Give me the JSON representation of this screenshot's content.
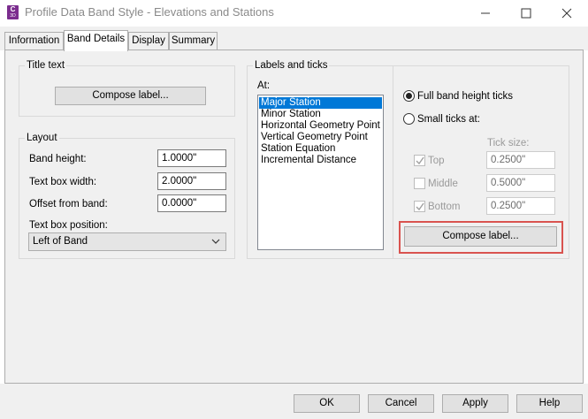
{
  "window": {
    "title": "Profile Data Band Style - Elevations and Stations",
    "icon_text": "C",
    "icon_sub": "3D"
  },
  "tabs": [
    {
      "label": "Information"
    },
    {
      "label": "Band Details"
    },
    {
      "label": "Display"
    },
    {
      "label": "Summary"
    }
  ],
  "title_text": {
    "group_label": "Title text",
    "compose_label": "Compose label..."
  },
  "layout": {
    "group_label": "Layout",
    "band_height_label": "Band height:",
    "band_height_value": "1.0000\"",
    "text_box_width_label": "Text box width:",
    "text_box_width_value": "2.0000\"",
    "offset_label": "Offset from band:",
    "offset_value": "0.0000\"",
    "position_label": "Text box position:",
    "position_value": "Left of Band"
  },
  "labels_ticks": {
    "group_label": "Labels and ticks",
    "at_label": "At:",
    "items": [
      "Major Station",
      "Minor Station",
      "Horizontal Geometry Point",
      "Vertical Geometry Point",
      "Station Equation",
      "Incremental Distance"
    ],
    "full_band_label": "Full band height ticks",
    "small_ticks_label": "Small ticks at:",
    "tick_size_label": "Tick size:",
    "top_label": "Top",
    "top_value": "0.2500\"",
    "middle_label": "Middle",
    "middle_value": "0.5000\"",
    "bottom_label": "Bottom",
    "bottom_value": "0.2500\"",
    "compose_label": "Compose label..."
  },
  "footer": {
    "ok": "OK",
    "cancel": "Cancel",
    "apply": "Apply",
    "help": "Help"
  },
  "colors": {
    "accent": "#0078d7",
    "highlight": "#d9534f"
  }
}
